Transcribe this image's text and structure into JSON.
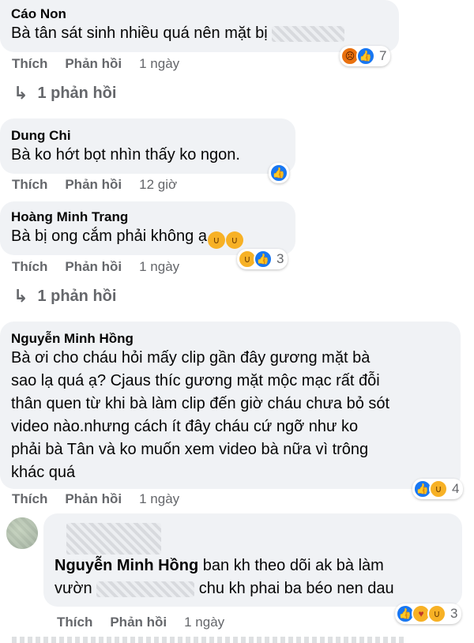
{
  "actions": {
    "like": "Thích",
    "reply": "Phản hồi"
  },
  "comments": [
    {
      "author": "Cáo Non",
      "text": "Bà tân sát sinh nhiều quá nên mặt bị",
      "time": "1 ngày",
      "reaction_count": "7",
      "reactions": [
        "angry-icon",
        "like-icon"
      ],
      "replies_link": "1 phản hồi"
    },
    {
      "author": "Dung Chi",
      "text": "Bà ko hớt bọt nhìn thấy ko ngon.",
      "time": "12 giờ",
      "reactions": [
        "like-icon"
      ]
    },
    {
      "author": "Hoàng Minh Trang",
      "text": "Bà bị ong cắm phải không ạ",
      "time": "1 ngày",
      "reaction_count": "3",
      "reactions": [
        "haha-icon",
        "like-icon"
      ],
      "replies_link": "1 phản hồi"
    },
    {
      "author": "Nguyễn Minh Hồng",
      "lines": [
        "Bà ơi cho cháu hỏi mấy clip gần đây gương mặt bà",
        "sao lạ quá ạ? Cjaus thíc gương mặt mộc mạc rất đỗi",
        "thân quen từ khi bà làm clip đến giờ cháu chưa bỏ sót",
        "video nào.nhưng cách ít đây cháu cứ ngỡ như ko",
        "phải bà Tân và ko muốn xem video bà nữa vì trông",
        "khác quá"
      ],
      "time": "1 ngày",
      "reaction_count": "4",
      "reactions": [
        "like-icon",
        "haha-icon"
      ]
    }
  ],
  "reply": {
    "mention": "Nguyễn Minh Hồng",
    "text_after_mention": "ban kh theo dõi ak bà làm",
    "line2_start": "vườn",
    "line2_end": "chu kh phai ba béo nen dau",
    "time": "1 ngày",
    "reaction_count": "3",
    "reactions": [
      "like-icon",
      "care-icon",
      "haha-icon"
    ]
  },
  "colors": {
    "bubble": "#f0f2f5",
    "secondary_text": "#65676b",
    "like_blue": "#1877f2",
    "haha_yellow": "#f7b125",
    "angry_orange": "#e9710f"
  }
}
